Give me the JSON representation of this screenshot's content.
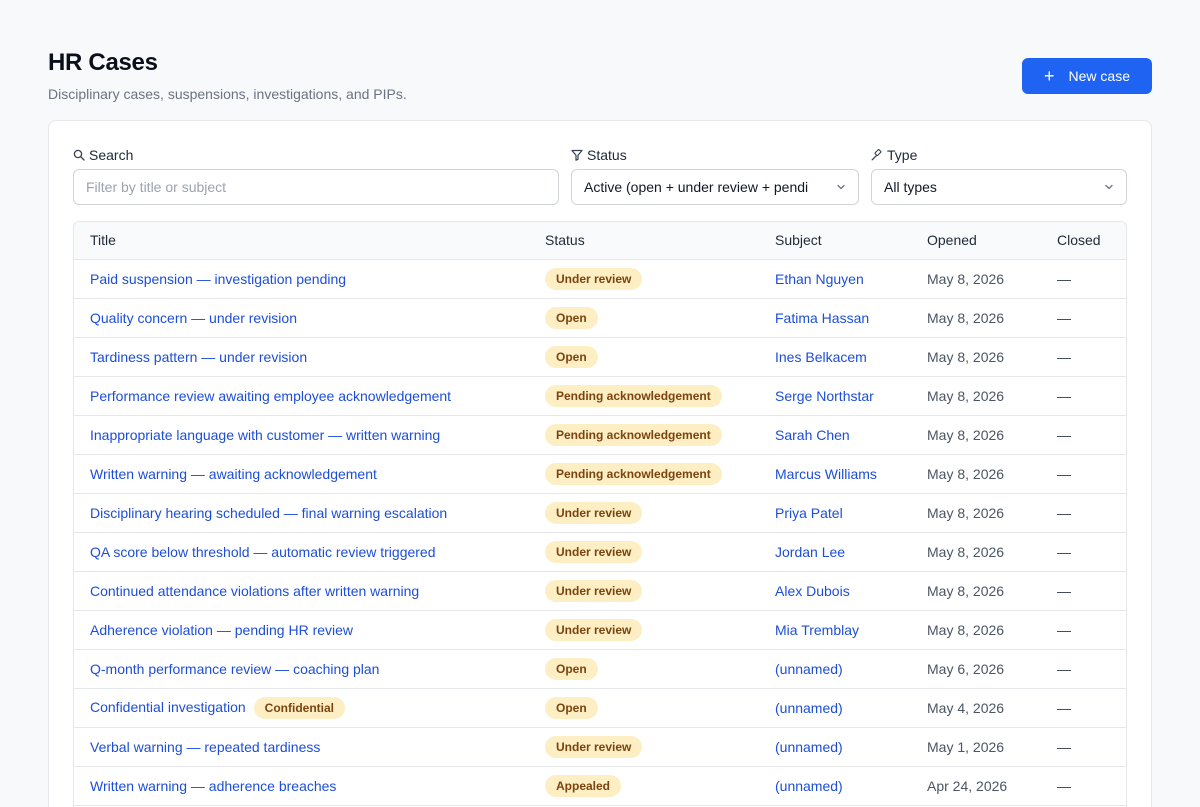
{
  "header": {
    "title": "HR Cases",
    "subtitle": "Disciplinary cases, suspensions, investigations, and PIPs.",
    "new_case_label": "New case",
    "new_case_icon": "plus-icon"
  },
  "filters": {
    "search": {
      "label": "Search",
      "placeholder": "Filter by title or subject",
      "value": "",
      "icon": "search-icon"
    },
    "status": {
      "label": "Status",
      "value": "Active (open + under review + pendi",
      "icon": "filter-icon"
    },
    "type": {
      "label": "Type",
      "value": "All types",
      "icon": "gavel-icon"
    }
  },
  "table": {
    "columns": [
      "Title",
      "Status",
      "Subject",
      "Opened",
      "Closed"
    ],
    "rows": [
      {
        "title": "Paid suspension — investigation pending",
        "tag": "",
        "status": "Under review",
        "subject": "Ethan Nguyen",
        "opened": "May 8, 2026",
        "closed": "—"
      },
      {
        "title": "Quality concern — under revision",
        "tag": "",
        "status": "Open",
        "subject": "Fatima Hassan",
        "opened": "May 8, 2026",
        "closed": "—"
      },
      {
        "title": "Tardiness pattern — under revision",
        "tag": "",
        "status": "Open",
        "subject": "Ines Belkacem",
        "opened": "May 8, 2026",
        "closed": "—"
      },
      {
        "title": "Performance review awaiting employee acknowledgement",
        "tag": "",
        "status": "Pending acknowledgement",
        "subject": "Serge Northstar",
        "opened": "May 8, 2026",
        "closed": "—"
      },
      {
        "title": "Inappropriate language with customer — written warning",
        "tag": "",
        "status": "Pending acknowledgement",
        "subject": "Sarah Chen",
        "opened": "May 8, 2026",
        "closed": "—"
      },
      {
        "title": "Written warning — awaiting acknowledgement",
        "tag": "",
        "status": "Pending acknowledgement",
        "subject": "Marcus Williams",
        "opened": "May 8, 2026",
        "closed": "—"
      },
      {
        "title": "Disciplinary hearing scheduled — final warning escalation",
        "tag": "",
        "status": "Under review",
        "subject": "Priya Patel",
        "opened": "May 8, 2026",
        "closed": "—"
      },
      {
        "title": "QA score below threshold — automatic review triggered",
        "tag": "",
        "status": "Under review",
        "subject": "Jordan Lee",
        "opened": "May 8, 2026",
        "closed": "—"
      },
      {
        "title": "Continued attendance violations after written warning",
        "tag": "",
        "status": "Under review",
        "subject": "Alex Dubois",
        "opened": "May 8, 2026",
        "closed": "—"
      },
      {
        "title": "Adherence violation — pending HR review",
        "tag": "",
        "status": "Under review",
        "subject": "Mia Tremblay",
        "opened": "May 8, 2026",
        "closed": "—"
      },
      {
        "title": "Q-month performance review — coaching plan",
        "tag": "",
        "status": "Open",
        "subject": "(unnamed)",
        "opened": "May 6, 2026",
        "closed": "—"
      },
      {
        "title": "Confidential investigation",
        "tag": "Confidential",
        "status": "Open",
        "subject": "(unnamed)",
        "opened": "May 4, 2026",
        "closed": "—"
      },
      {
        "title": "Verbal warning — repeated tardiness",
        "tag": "",
        "status": "Under review",
        "subject": "(unnamed)",
        "opened": "May 1, 2026",
        "closed": "—"
      },
      {
        "title": "Written warning — adherence breaches",
        "tag": "",
        "status": "Appealed",
        "subject": "(unnamed)",
        "opened": "Apr 24, 2026",
        "closed": "—"
      }
    ]
  },
  "colors": {
    "accent": "#1f63f2",
    "link": "#1d4ed8",
    "badge_bg": "#fdefc3",
    "badge_text": "#7a4310"
  }
}
